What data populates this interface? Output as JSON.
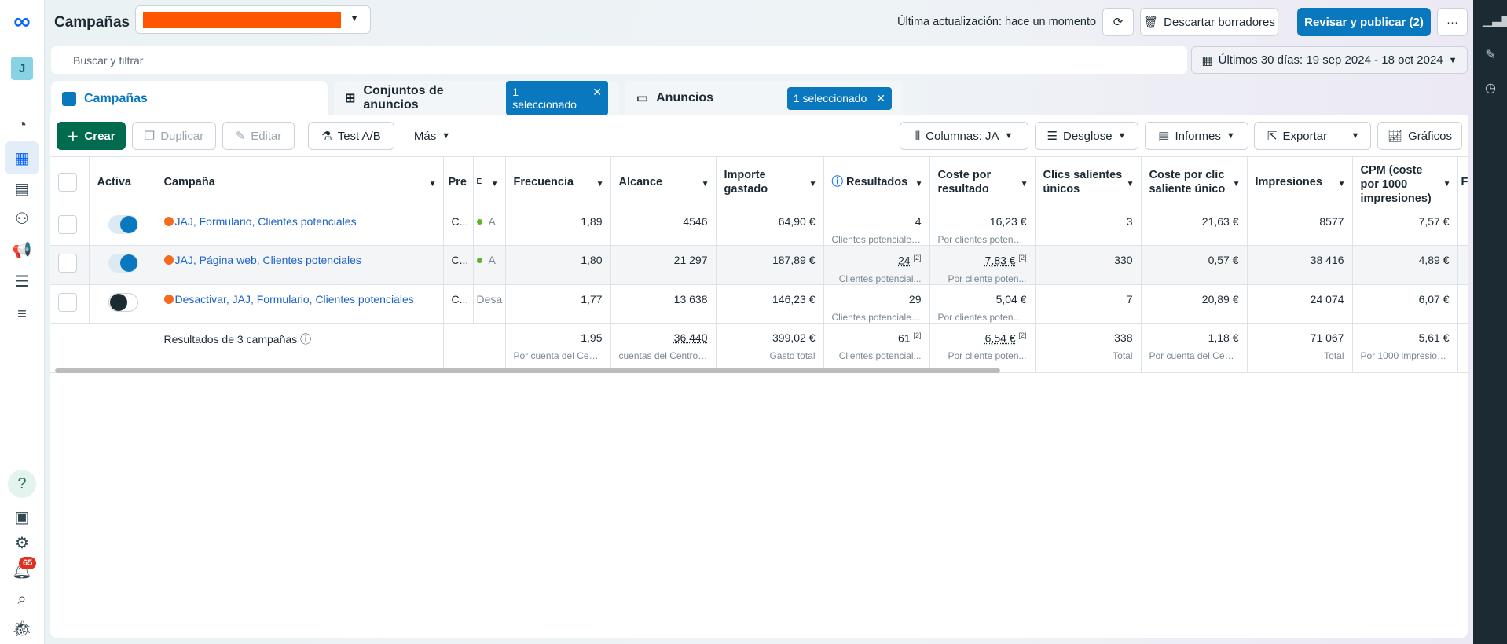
{
  "header": {
    "title": "Campañas",
    "account_selector_redacted": true,
    "last_update": "Última actualización: hace un momento",
    "discard_label": "Descartar borradores",
    "publish_label": "Revisar y publicar (2)",
    "more_label": "···"
  },
  "search": {
    "placeholder": "Buscar y filtrar",
    "date_range": "Últimos 30 días: 19 sep 2024 - 18 oct 2024"
  },
  "sidebar": {
    "avatar": "J",
    "notification_count": "65",
    "help": "?"
  },
  "tabs": [
    {
      "label": "Campañas"
    },
    {
      "label": "Conjuntos de anuncios",
      "chip": "1 seleccionado"
    },
    {
      "label": "Anuncios",
      "chip": "1 seleccionado"
    }
  ],
  "toolbar": {
    "create": "Crear",
    "duplicate": "Duplicar",
    "edit": "Editar",
    "abtest": "Test A/B",
    "more": "Más",
    "columns": "Columnas: JA",
    "breakdown": "Desglose",
    "reports": "Informes",
    "export": "Exportar",
    "charts": "Gráficos"
  },
  "table": {
    "headers": [
      "Activa",
      "Campaña",
      "Pre",
      "E",
      "Frecuencia",
      "Alcance",
      "Importe gastado",
      "Resultados",
      "Coste por resultado",
      "Clics salientes únicos",
      "Coste por clic saliente único",
      "Impresiones",
      "CPM (coste por 1000 impresiones)",
      "F"
    ],
    "rows": [
      {
        "active": true,
        "name": "JAJ, Formulario, Clientes potenciales",
        "pre": "C...",
        "status": "A",
        "freq": "1,89",
        "reach": "4546",
        "spent": "64,90 €",
        "results": "4",
        "results_sub": "Clientes potenciales...",
        "cpr": "16,23 €",
        "cpr_sub": "Por clientes potenci...",
        "clicks": "3",
        "cpc": "21,63 €",
        "impr": "8577",
        "cpm": "7,57 €"
      },
      {
        "active": true,
        "name": "JAJ, Página web, Clientes potenciales",
        "pre": "C...",
        "status": "A",
        "freq": "1,80",
        "reach": "21 297",
        "spent": "187,89 €",
        "results": "24",
        "results_note": "[2]",
        "results_sub": "Clientes potencial...",
        "cpr": "7,83 €",
        "cpr_note": "[2]",
        "cpr_sub": "Por cliente poten...",
        "clicks": "330",
        "cpc": "0,57 €",
        "impr": "38 416",
        "cpm": "4,89 €"
      },
      {
        "active": false,
        "name": "Desactivar, JAJ, Formulario, Clientes potenciales",
        "pre": "C...",
        "status": "Desa",
        "freq": "1,77",
        "reach": "13 638",
        "spent": "146,23 €",
        "results": "29",
        "results_sub": "Clientes potenciales...",
        "cpr": "5,04 €",
        "cpr_sub": "Por clientes potenci...",
        "clicks": "7",
        "cpc": "20,89 €",
        "impr": "24 074",
        "cpm": "6,07 €"
      }
    ],
    "totals": {
      "label": "Resultados de 3 campañas",
      "freq": "1,95",
      "freq_sub": "Por cuenta del Centr...",
      "reach": "36 440",
      "reach_sub": "cuentas del Centro ...",
      "spent": "399,02 €",
      "spent_sub": "Gasto total",
      "results": "61",
      "results_note": "[2]",
      "results_sub": "Clientes potencial...",
      "cpr": "6,54 €",
      "cpr_note": "[2]",
      "cpr_sub": "Por cliente poten...",
      "clicks": "338",
      "clicks_sub": "Total",
      "cpc": "1,18 €",
      "cpc_sub": "Por cuenta del Centr...",
      "impr": "71 067",
      "impr_sub": "Total",
      "cpm": "5,61 €",
      "cpm_sub": "Por 1000 impresiones"
    }
  },
  "colors": {
    "accent": "#0a78be",
    "create": "#006b4f",
    "campaign_dot": "#f46b1e",
    "active_dot": "#5eb52b",
    "redaction": "#ff5500"
  }
}
